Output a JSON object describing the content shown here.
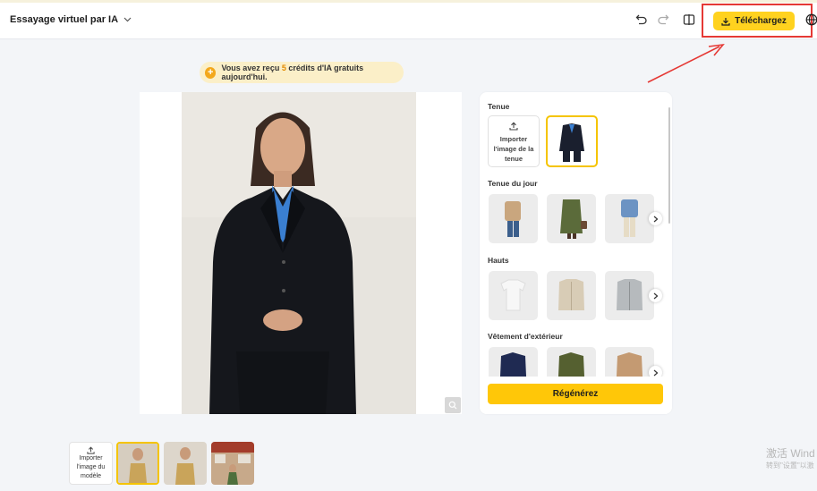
{
  "header": {
    "title": "Essayage virtuel par IA",
    "download_label": "Téléchargez"
  },
  "banner": {
    "prefix": "Vous avez reçu ",
    "credits": "5",
    "suffix": " crédits d'IA gratuits aujourd'hui."
  },
  "panel": {
    "outfit_title": "Tenue",
    "upload_outfit_label": "Importer l'image de la tenue",
    "outfit_of_day_title": "Tenue du jour",
    "tops_title": "Hauts",
    "outerwear_title": "Vêtement d'extérieur",
    "regenerate_label": "Régénérez"
  },
  "bottom": {
    "upload_model_label": "Importer l'image du modèle"
  },
  "watermark": {
    "line1": "激活 Wind",
    "line2": "转到\"设置\"以激"
  },
  "colors": {
    "accent": "#ffc708",
    "annotation_red": "#e53935"
  }
}
